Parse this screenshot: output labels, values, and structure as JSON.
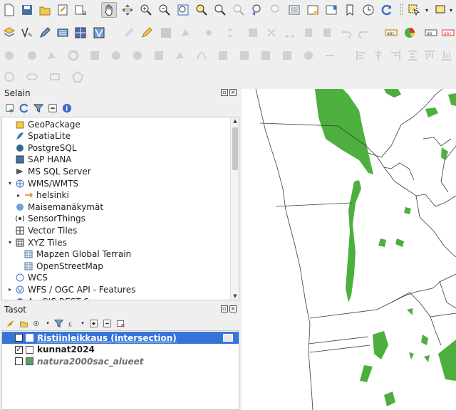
{
  "toolbar": {
    "row1": [
      "new-project-icon",
      "save-project-icon",
      "open-project-icon",
      "layout-manager-icon",
      "style-manager-icon",
      "pan-icon",
      "pan-to-selection-icon",
      "zoom-in-icon",
      "zoom-out-icon",
      "zoom-full-icon",
      "zoom-to-selection-icon",
      "zoom-to-layer-icon",
      "zoom-native-icon",
      "zoom-last-icon",
      "zoom-next-icon",
      "new-map-view-icon",
      "new-bookmark-icon",
      "show-bookmarks-icon",
      "temporal-controller-icon",
      "refresh-icon",
      "select-features-icon"
    ],
    "row2": [
      "add-layer-icon",
      "digitize-icon",
      "pencil-icon",
      "add-raster-icon",
      "add-mesh-icon",
      "add-vector-icon"
    ],
    "row4": [
      "measure-icon"
    ]
  },
  "browser": {
    "title": "Selain",
    "items": [
      {
        "label": "GeoPackage",
        "icon": "geopackage-icon",
        "expand": ""
      },
      {
        "label": "SpatiaLite",
        "icon": "spatialite-icon",
        "expand": ""
      },
      {
        "label": "PostgreSQL",
        "icon": "postgresql-icon",
        "expand": ""
      },
      {
        "label": "SAP HANA",
        "icon": "saphana-icon",
        "expand": ""
      },
      {
        "label": "MS SQL Server",
        "icon": "mssql-icon",
        "expand": ""
      },
      {
        "label": "WMS/WMTS",
        "icon": "wms-icon",
        "expand": "▾"
      },
      {
        "label": "helsinki",
        "icon": "wms-connection-icon",
        "expand": "▸",
        "indent": 1
      },
      {
        "label": "Maisemanäkymät",
        "icon": "scenes-icon",
        "expand": ""
      },
      {
        "label": "SensorThings",
        "icon": "sensorthings-icon",
        "expand": ""
      },
      {
        "label": "Vector Tiles",
        "icon": "vectortiles-icon",
        "expand": ""
      },
      {
        "label": "XYZ Tiles",
        "icon": "xyz-icon",
        "expand": "▾"
      },
      {
        "label": "Mapzen Global Terrain",
        "icon": "xyz-tile-icon",
        "expand": "",
        "indent": 1
      },
      {
        "label": "OpenStreetMap",
        "icon": "xyz-tile-icon",
        "expand": "",
        "indent": 1
      },
      {
        "label": "WCS",
        "icon": "wcs-icon",
        "expand": ""
      },
      {
        "label": "WFS / OGC API - Features",
        "icon": "wfs-icon",
        "expand": "▸"
      },
      {
        "label": "ArcGIS REST Servers",
        "icon": "arcgis-icon",
        "expand": "▸"
      }
    ]
  },
  "layers": {
    "title": "Tasot",
    "items": [
      {
        "label": "Ristiinleikkaus (intersection)",
        "checked": true,
        "color": "#4a4a4a",
        "style": "selected",
        "swatch": "#ffffff"
      },
      {
        "label": "kunnat2024",
        "checked": true,
        "color": "#1e1e1e",
        "style": "bold",
        "swatch": "#ffffff"
      },
      {
        "label": "natura2000sac_alueet",
        "checked": false,
        "color": "#6e6e6e",
        "style": "italic",
        "swatch": "#5f9f5f"
      }
    ]
  },
  "map": {
    "polygon_color": "#4caf3e",
    "boundary_color": "#3a3a3a"
  }
}
